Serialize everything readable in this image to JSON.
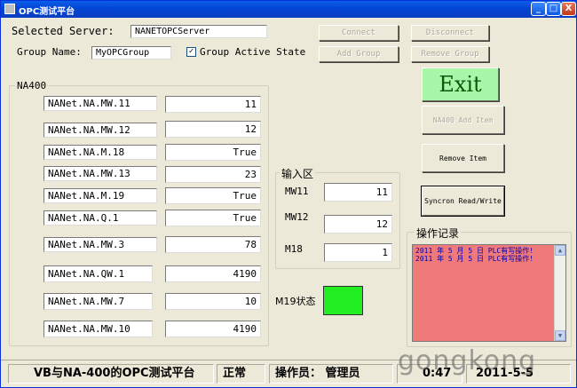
{
  "window": {
    "title": "OPC测试平台",
    "minimize_glyph": "_",
    "maximize_glyph": "□",
    "close_glyph": "X"
  },
  "server": {
    "label": "Selected Server:",
    "value": "NANETOPCServer"
  },
  "group": {
    "label": "Group Name:",
    "value": "MyOPCGroup",
    "active_label": "Group Active State",
    "active_checked": true,
    "check_glyph": "✓"
  },
  "buttons": {
    "connect": "Connect",
    "disconnect": "Disconnect",
    "add_group": "Add Group",
    "remove_group": "Remove Group",
    "exit": "Exit",
    "add_item": "NA400 Add Item",
    "remove_item": "Remove Item",
    "sync": "Syncron Read/Write"
  },
  "na400": {
    "title": "NA400",
    "items": [
      {
        "name": "NANet.NA.MW.11",
        "value": "11"
      },
      {
        "name": "NANet.NA.MW.12",
        "value": "12"
      },
      {
        "name": "NANet.NA.M.18",
        "value": "True"
      },
      {
        "name": "NANet.NA.MW.13",
        "value": "23"
      },
      {
        "name": "NANet.NA.M.19",
        "value": "True"
      },
      {
        "name": "NANet.NA.Q.1",
        "value": "True"
      },
      {
        "name": "NANet.NA.MW.3",
        "value": "78"
      },
      {
        "name": "NANet.NA.QW.1",
        "value": "4190"
      },
      {
        "name": "NANet.NA.MW.7",
        "value": "10"
      },
      {
        "name": "NANet.NA.MW.10",
        "value": "4190"
      }
    ]
  },
  "input": {
    "title": "输入区",
    "rows": [
      {
        "label": "MW11",
        "value": "11"
      },
      {
        "label": "MW12",
        "value": "12"
      },
      {
        "label": "M18",
        "value": "1"
      }
    ]
  },
  "m19": {
    "label": "M19状态",
    "indicator_color": "#22ee22"
  },
  "log": {
    "title": "操作记录",
    "lines": [
      "2011 年 5 月  5 日  PLC有写操作!",
      "2011 年 5 月  5 日  PLC有写操作!"
    ],
    "scroll_up": "▲",
    "scroll_down": "▼"
  },
  "status": {
    "app": "VB与NA-400的OPC测试平台",
    "state": "正常",
    "operator": "操作员： 管理员",
    "time": "0:47",
    "date": "2011-5-5"
  },
  "watermark": "gongkong"
}
